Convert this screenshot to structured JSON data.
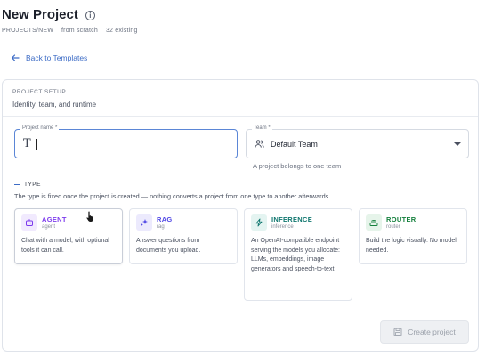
{
  "header": {
    "title": "New Project",
    "breadcrumb": "PROJECTS/NEW",
    "mode": "from scratch",
    "existing_count": "32 existing"
  },
  "back_link": {
    "label": "Back to Templates"
  },
  "setup": {
    "kicker": "PROJECT SETUP",
    "subtitle": "Identity, team, and runtime"
  },
  "form": {
    "project_name_label": "Project name *",
    "project_name_value": "",
    "team_label": "Team *",
    "team_value": "Default Team",
    "team_help": "A project belongs to one team"
  },
  "type_section": {
    "heading": "TYPE",
    "description": "The type is fixed once the project is created — nothing converts a project from one type to another afterwards.",
    "types": [
      {
        "name": "AGENT",
        "slug": "agent",
        "description": "Chat with a model, with optional tools it can call.",
        "icon": "robot-icon",
        "color": "#7c3aed",
        "bg": "#f1eafe",
        "selected": true
      },
      {
        "name": "RAG",
        "slug": "rag",
        "description": "Answer questions from documents you upload.",
        "icon": "sparkle-icon",
        "color": "#4f46e5",
        "bg": "#eceafd",
        "selected": false
      },
      {
        "name": "INFERENCE",
        "slug": "inference",
        "description": "An OpenAI-compatible endpoint serving the models you allocate: LLMs, embeddings, image generators and speech-to-text.",
        "icon": "bolt-icon",
        "color": "#0f766e",
        "bg": "#e4f4f1",
        "selected": false
      },
      {
        "name": "ROUTER",
        "slug": "router",
        "description": "Build the logic visually. No model needed.",
        "icon": "router-icon",
        "color": "#15803d",
        "bg": "#e6f4ea",
        "selected": false
      }
    ]
  },
  "actions": {
    "create_label": "Create project"
  },
  "colors": {
    "accent": "#3d6cc6",
    "focus_border": "#5b86d6"
  }
}
